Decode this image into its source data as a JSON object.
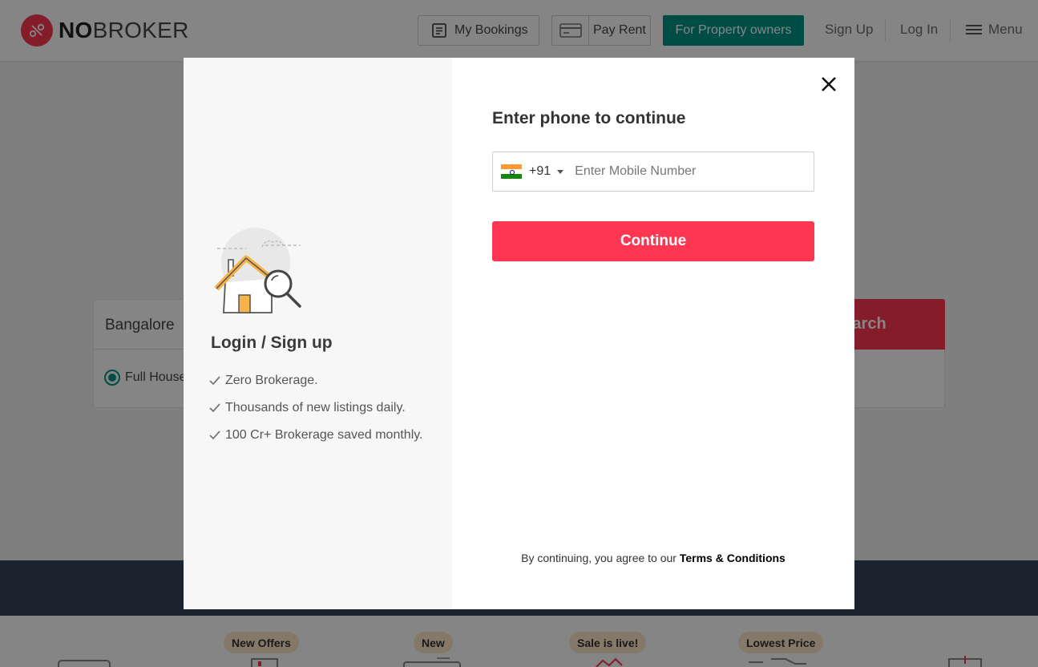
{
  "brand": {
    "logo_bold": "NO",
    "logo_rest": "BROKER",
    "accent": "#fd3752",
    "teal": "#009587"
  },
  "header": {
    "my_bookings": "My Bookings",
    "pay_rent": "Pay Rent",
    "for_owners": "For Property owners",
    "sign_up": "Sign Up",
    "log_in": "Log In",
    "menu": "Menu"
  },
  "search": {
    "city": "Bangalore",
    "button": "earch",
    "radio_label": "Full House"
  },
  "badges": [
    "New Offers",
    "New",
    "Sale is live!",
    "Lowest Price"
  ],
  "modal": {
    "left_title": "Login / Sign up",
    "benefits": [
      "Zero Brokerage.",
      "Thousands of new listings daily.",
      "100 Cr+ Brokerage saved monthly."
    ],
    "right_title": "Enter phone to continue",
    "country_code": "+91",
    "phone_placeholder": "Enter Mobile Number",
    "continue_label": "Continue",
    "terms_prefix": "By continuing, you agree to our ",
    "terms_link": "Terms & Conditions"
  }
}
